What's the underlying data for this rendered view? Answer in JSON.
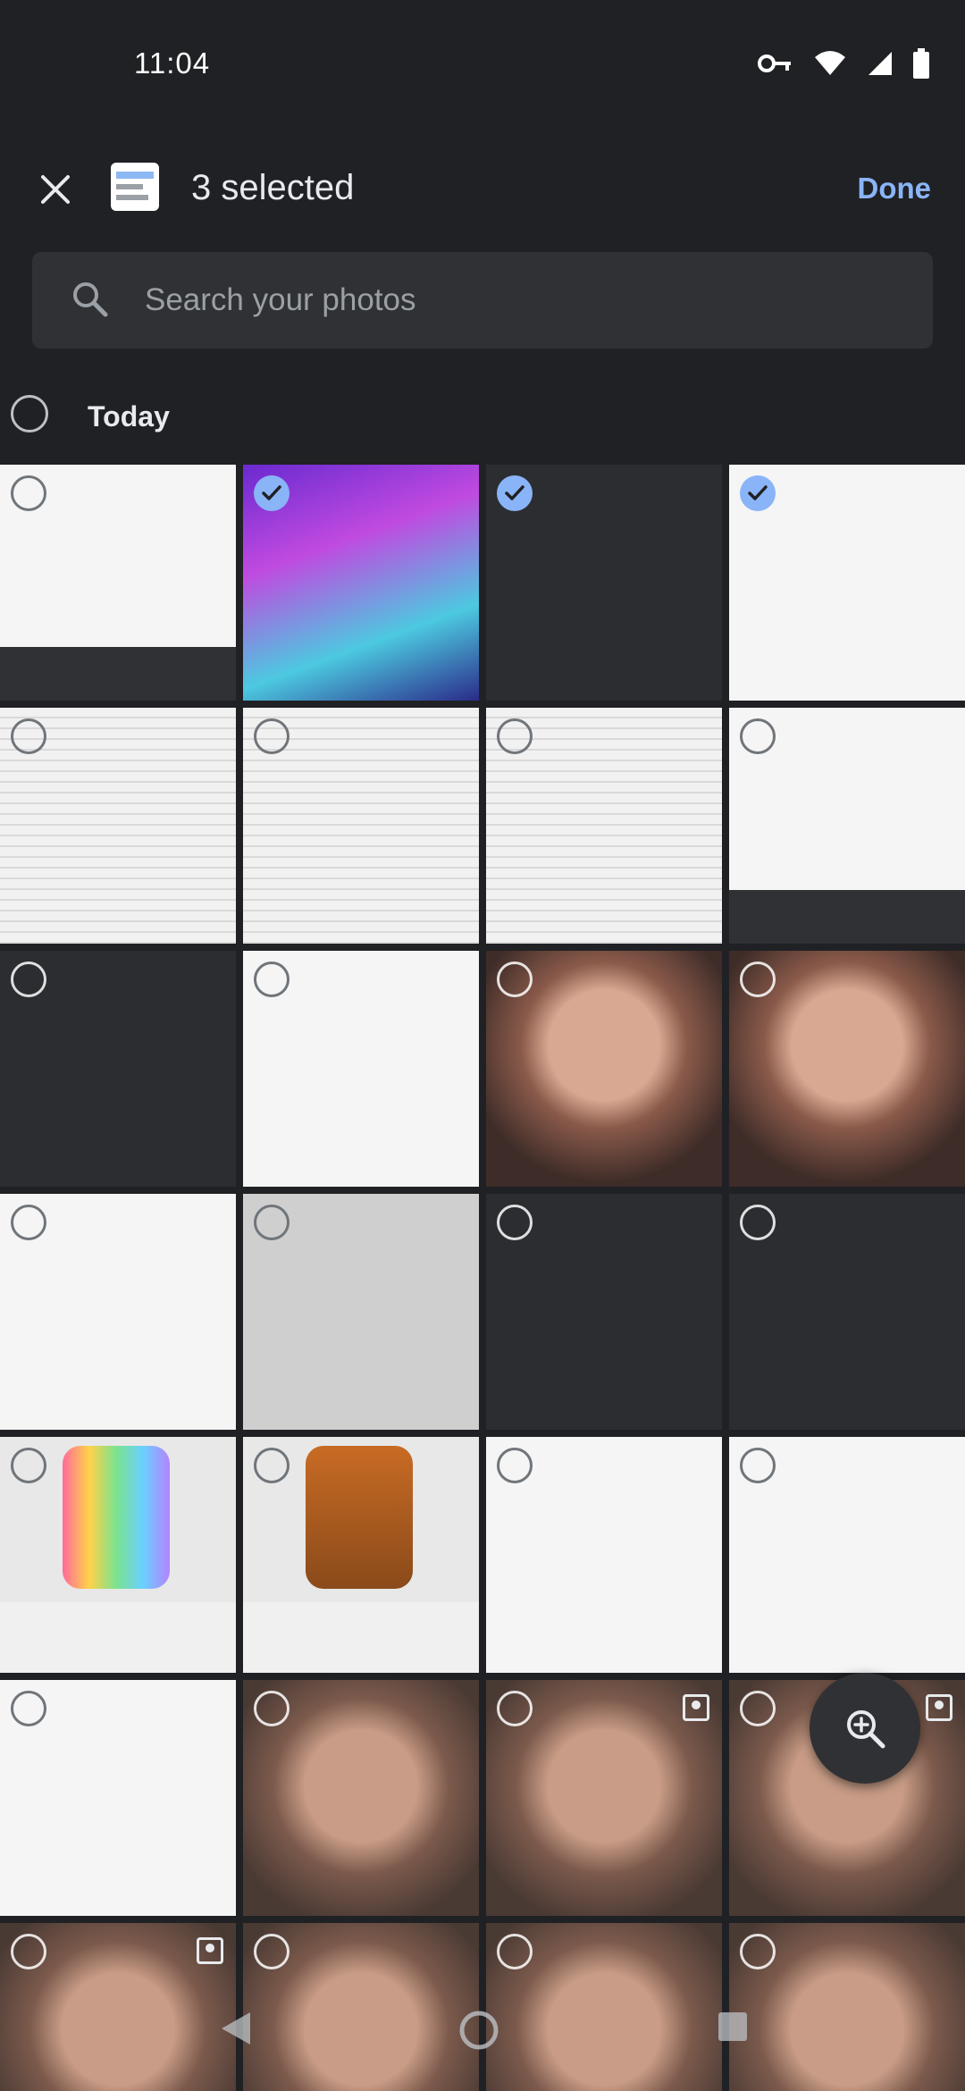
{
  "status": {
    "time": "11:04"
  },
  "header": {
    "selected_text": "3 selected",
    "done_label": "Done"
  },
  "search": {
    "placeholder": "Search your photos"
  },
  "section": {
    "date_label": "Today"
  },
  "grid": {
    "tiles": [
      {
        "style": "white",
        "checked": false
      },
      {
        "style": "purple",
        "checked": true
      },
      {
        "style": "darkui",
        "checked": true
      },
      {
        "style": "white",
        "checked": true
      },
      {
        "style": "lines",
        "checked": false
      },
      {
        "style": "lines",
        "checked": false
      },
      {
        "style": "lines",
        "checked": false
      },
      {
        "style": "white",
        "checked": false
      },
      {
        "style": "darkui",
        "checked": false
      },
      {
        "style": "white",
        "checked": false
      },
      {
        "style": "face",
        "checked": false
      },
      {
        "style": "face",
        "checked": false
      },
      {
        "style": "white",
        "checked": false
      },
      {
        "style": "grey",
        "checked": false
      },
      {
        "style": "darkui",
        "checked": false
      },
      {
        "style": "darkui",
        "checked": false
      },
      {
        "style": "pyjama",
        "checked": false
      },
      {
        "style": "pyjama-brown",
        "checked": false
      },
      {
        "style": "white",
        "checked": false
      },
      {
        "style": "white",
        "checked": false
      },
      {
        "style": "white",
        "checked": false
      },
      {
        "style": "face2",
        "checked": false
      },
      {
        "style": "face2",
        "checked": false,
        "contact": true
      },
      {
        "style": "face2",
        "checked": false,
        "contact": true
      },
      {
        "style": "face2",
        "checked": false,
        "contact": true
      },
      {
        "style": "face2",
        "checked": false
      },
      {
        "style": "face2",
        "checked": false
      },
      {
        "style": "face2",
        "checked": false
      }
    ]
  },
  "icons": {
    "close": "close-icon",
    "search": "search-icon",
    "zoom": "zoom-in-icon",
    "check": "check-icon"
  }
}
